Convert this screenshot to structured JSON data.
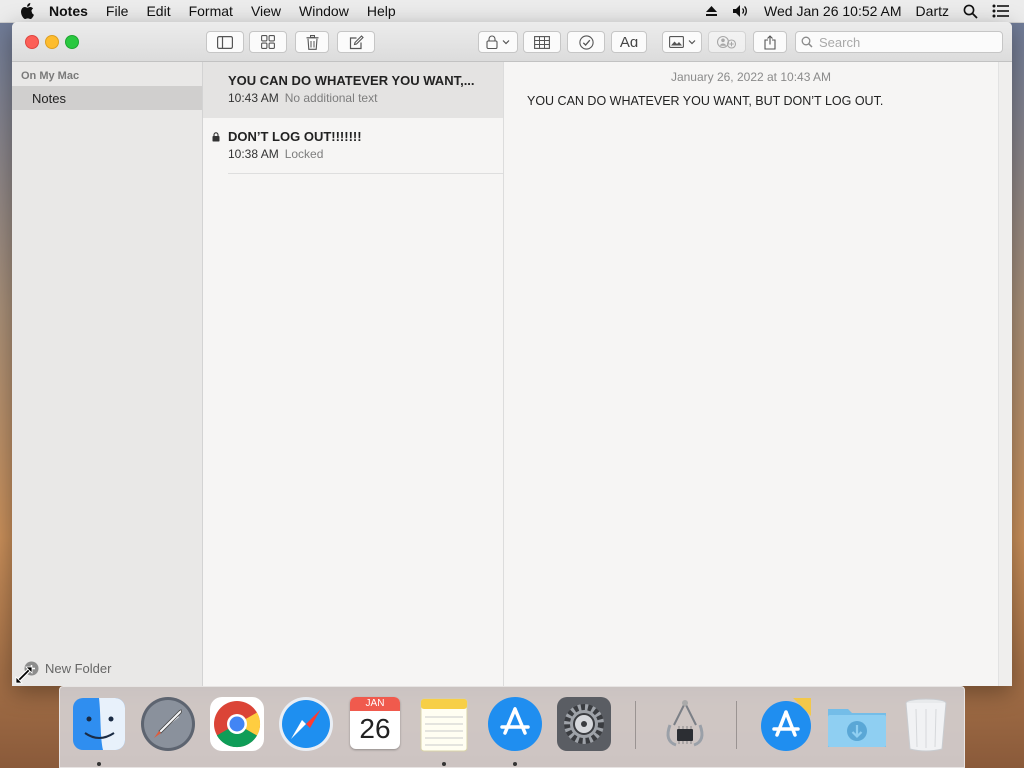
{
  "menubar": {
    "app_name": "Notes",
    "items": [
      "File",
      "Edit",
      "Format",
      "View",
      "Window",
      "Help"
    ],
    "datetime": "Wed Jan 26  10:52 AM",
    "user": "Dartz"
  },
  "toolbar": {
    "search_placeholder": "Search"
  },
  "sidebar": {
    "section": "On My Mac",
    "folder": "Notes",
    "new_folder": "New Folder"
  },
  "notes": [
    {
      "title": "YOU CAN DO WHATEVER YOU WANT,...",
      "time": "10:43 AM",
      "subtitle": "No additional text",
      "locked": false,
      "selected": true
    },
    {
      "title": "DON’T LOG OUT!!!!!!!",
      "time": "10:38 AM",
      "subtitle": "Locked",
      "locked": true,
      "selected": false
    }
  ],
  "editor": {
    "date": "January 26, 2022 at 10:43 AM",
    "body": "YOU CAN DO WHATEVER YOU WANT, BUT DON’T LOG OUT."
  },
  "dock": {
    "calendar_month": "JAN",
    "calendar_day": "26",
    "apps": [
      "finder",
      "launchpad",
      "chrome",
      "safari",
      "calendar",
      "notes",
      "app-store",
      "system-preferences",
      "system-information",
      "app-store-download",
      "downloads",
      "trash"
    ]
  },
  "colors": {
    "close": "#fc5f57",
    "minimize": "#fdbc2e",
    "maximize": "#29c840",
    "selection": "#d0cfce"
  }
}
